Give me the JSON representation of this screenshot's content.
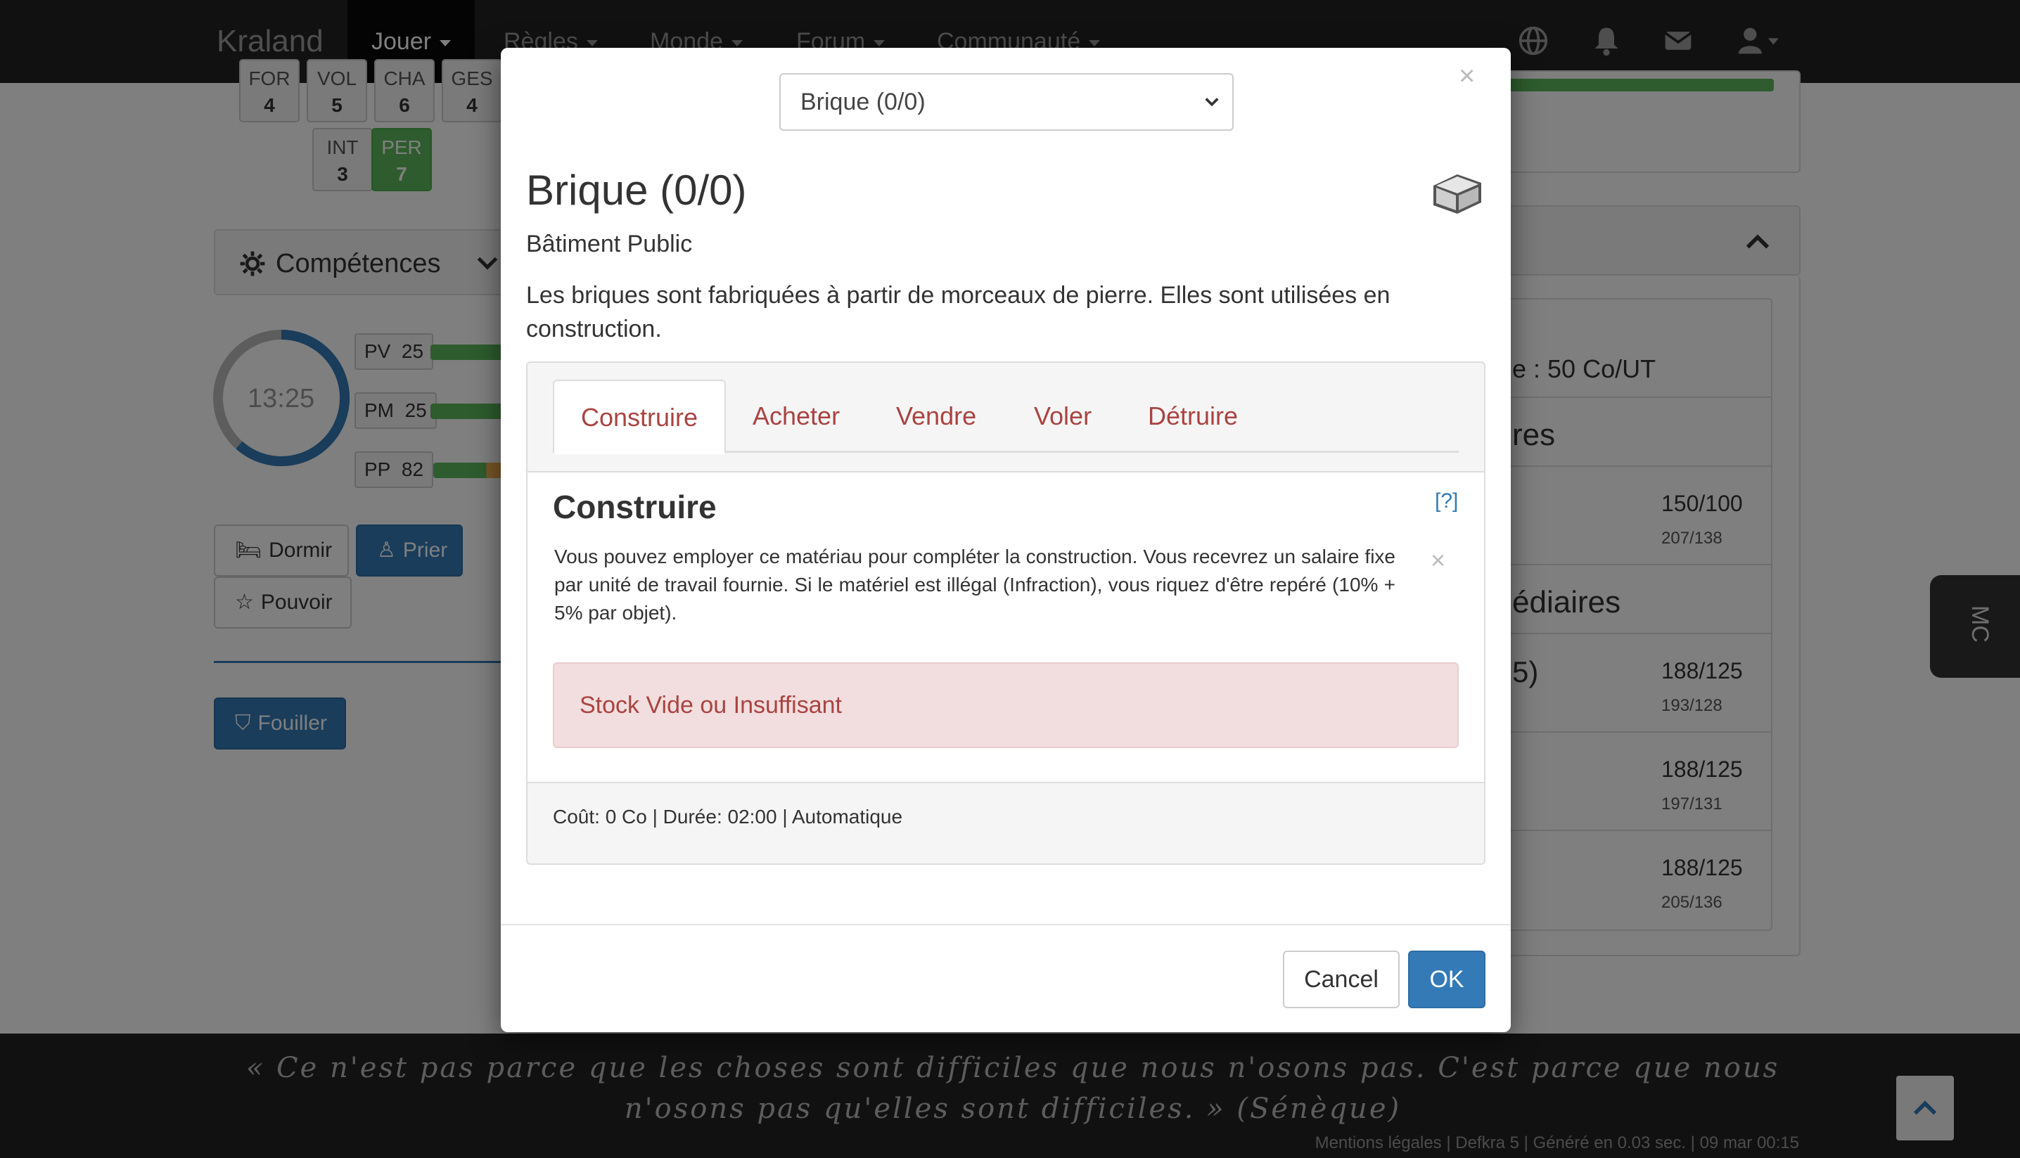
{
  "navbar": {
    "brand": "Kraland",
    "items": [
      {
        "label": "Jouer"
      },
      {
        "label": "Règles"
      },
      {
        "label": "Monde"
      },
      {
        "label": "Forum"
      },
      {
        "label": "Communauté"
      }
    ],
    "icons": [
      "globe-icon",
      "bell-icon",
      "envelope-icon",
      "user-icon"
    ]
  },
  "stats": {
    "row1": [
      {
        "label": "FOR",
        "value": "4"
      },
      {
        "label": "VOL",
        "value": "5"
      },
      {
        "label": "CHA",
        "value": "6"
      },
      {
        "label": "GES",
        "value": "4"
      }
    ],
    "row2": [
      {
        "label": "INT",
        "value": "3"
      },
      {
        "label": "PER",
        "value": "7"
      }
    ]
  },
  "competences": {
    "title": "Compétences"
  },
  "clock": {
    "time": "13:25"
  },
  "gauges": [
    {
      "label": "PV",
      "value": "25"
    },
    {
      "label": "PM",
      "value": "25"
    },
    {
      "label": "PP",
      "value": "82"
    }
  ],
  "actions": {
    "dormir": "Dormir",
    "prier": "Prier",
    "pouvoir": "Pouvoir",
    "fouiller": "Fouiller"
  },
  "right_panel": {
    "rate": "e : 50 Co/UT",
    "heading1": "res",
    "row1_num": "150/100",
    "row1_sub": "207/138",
    "heading2": "édiaires",
    "row2_label": "5)",
    "row2_num": "188/125",
    "row2_sub": "193/128",
    "row3_num": "188/125",
    "row3_sub": "197/131",
    "row4_num": "188/125",
    "row4_sub": "205/136"
  },
  "side_tab": {
    "label": "MC"
  },
  "footer": {
    "quote": "« Ce n'est pas parce que les choses sont difficiles que nous n'osons pas. C'est parce que nous n'osons pas qu'elles sont difficiles. » (Sénèque)",
    "legal": "Mentions légales | Defkra 5 | Généré en 0.03 sec. | 09 mar 00:15"
  },
  "modal": {
    "close": "×",
    "select_value": "Brique (0/0)",
    "title": "Brique (0/0)",
    "subtitle": "Bâtiment Public",
    "description": "Les briques sont fabriquées à partir de morceaux de pierre. Elles sont utilisées en construction.",
    "tabs": [
      {
        "label": "Construire"
      },
      {
        "label": "Acheter"
      },
      {
        "label": "Vendre"
      },
      {
        "label": "Voler"
      },
      {
        "label": "Détruire"
      }
    ],
    "section_title": "Construire",
    "help": "[?]",
    "info": "Vous pouvez employer ce matériau pour compléter la construction. Vous recevrez un salaire fixe par unité de travail fournie. Si le matériel est illégal (Infraction), vous riquez d'être repéré (10% + 5% par objet).",
    "info_close": "×",
    "alert": "Stock Vide ou Insuffisant",
    "cost": "Coût: 0 Co | Durée: 02:00 | Automatique",
    "cancel": "Cancel",
    "ok": "OK"
  },
  "colors": {
    "primary": "#337ab7",
    "danger_text": "#a94442",
    "danger_bg": "#f2dede",
    "success": "#5cb85c",
    "navbar": "#222222"
  }
}
